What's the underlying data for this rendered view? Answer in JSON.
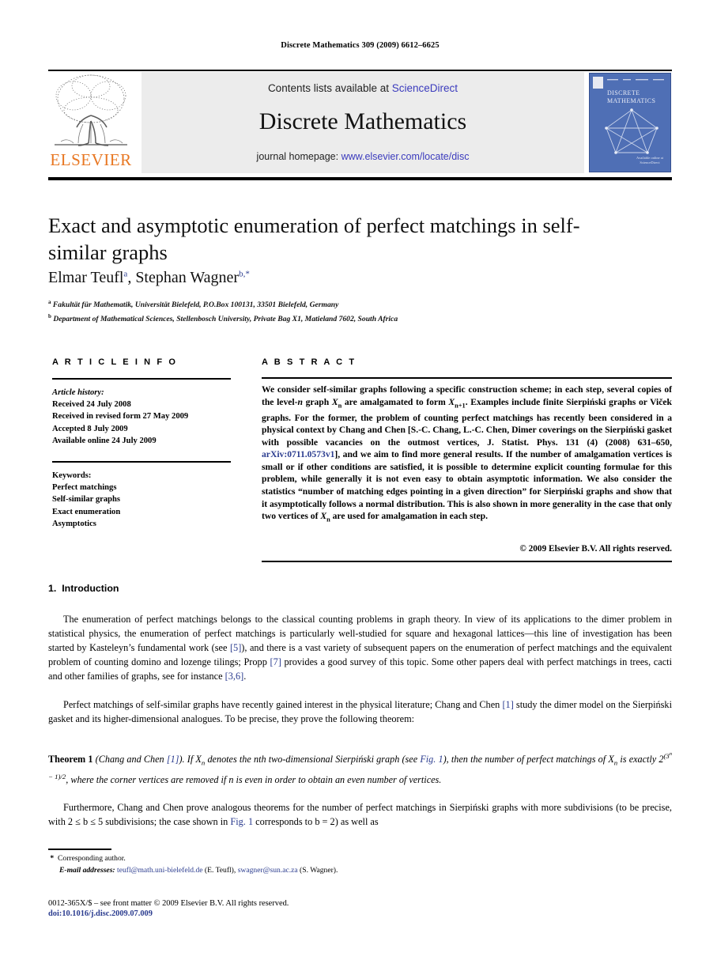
{
  "running_head": "Discrete Mathematics 309 (2009) 6612–6625",
  "masthead": {
    "contents_prefix": "Contents lists available at ",
    "sciencedirect": "ScienceDirect",
    "journal_name": "Discrete Mathematics",
    "homepage_prefix": "journal homepage: ",
    "homepage_url": "www.elsevier.com/locate/disc",
    "publisher_wordmark": "ELSEVIER",
    "cover_title": "DISCRETE MATHEMATICS",
    "cover_footer": "Available online at ScienceDirect",
    "link_color": "#3b3bbd",
    "cover_bg": "#4f6fb5",
    "elsevier_orange": "#E87722"
  },
  "article": {
    "title": "Exact and asymptotic enumeration of perfect matchings in self-similar graphs",
    "authors_plain": "Elmar Teufl a, Stephan Wagner b,*",
    "author_1": "Elmar Teufl",
    "author_1_sup": "a",
    "author_2": "Stephan Wagner",
    "author_2_sup": "b,*",
    "affiliation_a_marker": "a",
    "affiliation_a": "Fakultät für Mathematik, Universität Bielefeld, P.O.Box 100131, 33501 Bielefeld, Germany",
    "affiliation_b_marker": "b",
    "affiliation_b": "Department of Mathematical Sciences, Stellenbosch University, Private Bag X1, Matieland 7602, South Africa"
  },
  "article_info": {
    "heading": "A R T I C L E   I N F O",
    "history_label": "Article history:",
    "history": [
      "Received 24 July 2008",
      "Received in revised form 27 May 2009",
      "Accepted 8 July 2009",
      "Available online 24 July 2009"
    ],
    "keywords_label": "Keywords:",
    "keywords": [
      "Perfect matchings",
      "Self-similar graphs",
      "Exact enumeration",
      "Asymptotics"
    ]
  },
  "abstract": {
    "heading": "A B S T R A C T",
    "part_1": "We consider self-similar graphs following a specific construction scheme; in each step, several copies of the level-",
    "level_n": "n",
    "part_2": " graph ",
    "Xn": "X",
    "n_sub": "n",
    "part_3": " are amalgamated to form ",
    "Xn1": "X",
    "n1_sub": "n+1",
    "part_4": ". Examples include finite Sierpiński graphs or Viček graphs. For the former, the problem of counting perfect matchings has recently been considered in a physical context by Chang and Chen [S.-C. Chang, L.-C. Chen, Dimer coverings on the Sierpiński gasket with possible vacancies on the outmost vertices, J. Statist. Phys. 131 (4) (2008) 631–650, ",
    "arxiv_link": "arXiv:0711.0573v1",
    "part_5": "], and we aim to find more general results. If the number of amalgamation vertices is small or if other conditions are satisfied, it is possible to determine explicit counting formulae for this problem, while generally it is not even easy to obtain asymptotic information. We also consider the statistics “number of matching edges pointing in a given direction” for Sierpiński graphs and show that it asymptotically follows a normal distribution. This is also shown in more generality in the case that only two vertices of ",
    "part_6": " are used for amalgamation in each step.",
    "copyright": "© 2009 Elsevier B.V. All rights reserved."
  },
  "body": {
    "section_number": "1.",
    "section_title": "Introduction",
    "p1_a": "The enumeration of perfect matchings belongs to the classical counting problems in graph theory. In view of its applications to the dimer problem in statistical physics, the enumeration of perfect matchings is particularly well-studied for square and hexagonal lattices—this line of investigation has been started by Kasteleyn’s fundamental work (see ",
    "ref_5": "[5]",
    "p1_b": "), and there is a vast variety of subsequent papers on the enumeration of perfect matchings and the equivalent problem of counting domino and lozenge tilings; Propp ",
    "ref_7": "[7]",
    "p1_c": " provides a good survey of this topic. Some other papers deal with perfect matchings in trees, cacti and other families of graphs, see for instance ",
    "ref_36": "[3,6]",
    "p1_d": ".",
    "p2_a": "Perfect matchings of self-similar graphs have recently gained interest in the physical literature; Chang and Chen ",
    "ref_1": "[1]",
    "p2_b": " study the dimer model on the Sierpiński gasket and its higher-dimensional analogues. To be precise, they prove the following theorem:",
    "theorem_label": "Theorem 1",
    "theorem_attrib_open": " (Chang and Chen ",
    "theorem_ref": "[1]",
    "theorem_attrib_close": "). If ",
    "theorem_a": " denotes the nth two-dimensional Sierpiński graph (see ",
    "fig_ref_1": "Fig. 1",
    "theorem_b": "), then the number of perfect matchings of ",
    "theorem_c": " is exactly 2",
    "theorem_exp_base": "(3",
    "theorem_exp_n": "n",
    "theorem_exp_rest": " − 1)/2",
    "theorem_d": ", where the corner vertices are removed if n is even in order to obtain an even number of vertices.",
    "p3_a": "Furthermore, Chang and Chen prove analogous theorems for the number of perfect matchings in Sierpiński graphs with more subdivisions (to be precise, with 2 ≤ b ≤ 5 subdivisions; the case shown in ",
    "fig_ref_2": "Fig. 1",
    "p3_b": " corresponds to b = 2) as well as"
  },
  "footnotes": {
    "star": "*",
    "corresponding": "Corresponding author.",
    "email_label": "E-mail addresses:",
    "email_1": "teufl@math.uni-bielefeld.de",
    "email_1_owner": " (E. Teufl), ",
    "email_2": "swagner@sun.ac.za",
    "email_2_owner": " (S. Wagner).",
    "frontmatter": "0012-365X/$ – see front matter © 2009 Elsevier B.V. All rights reserved.",
    "doi": "doi:10.1016/j.disc.2009.07.009"
  }
}
